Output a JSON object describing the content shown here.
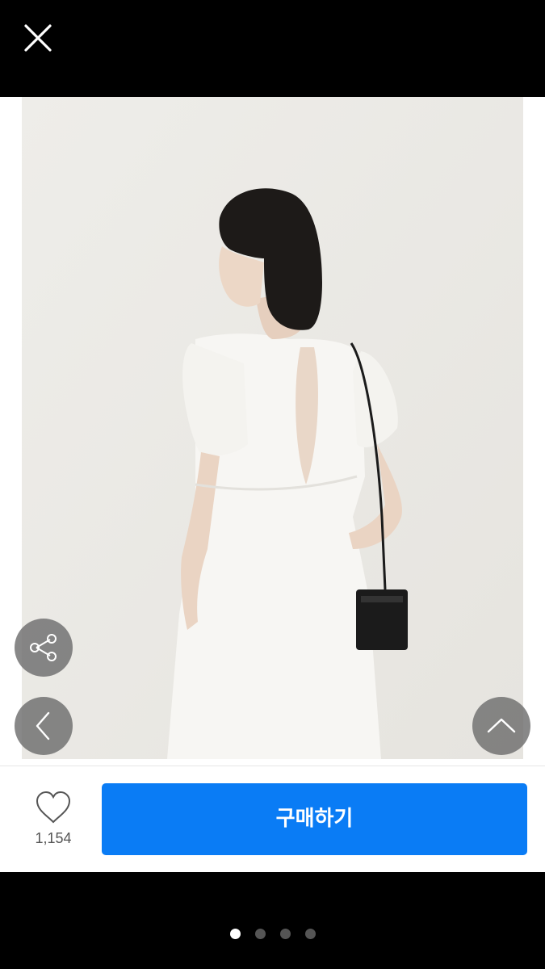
{
  "header": {
    "close_icon": "close-icon"
  },
  "product": {
    "image_description_icon": "product-photo",
    "colors": {
      "accent": "#0a7cf5",
      "background": "#ecebe7"
    }
  },
  "overlay_buttons": {
    "share_icon": "share-icon",
    "prev_icon": "chevron-left-icon",
    "scroll_top_icon": "chevron-up-icon"
  },
  "actions": {
    "like_count": "1,154",
    "buy_label": "구매하기"
  },
  "pager": {
    "total": 4,
    "current": 1
  }
}
